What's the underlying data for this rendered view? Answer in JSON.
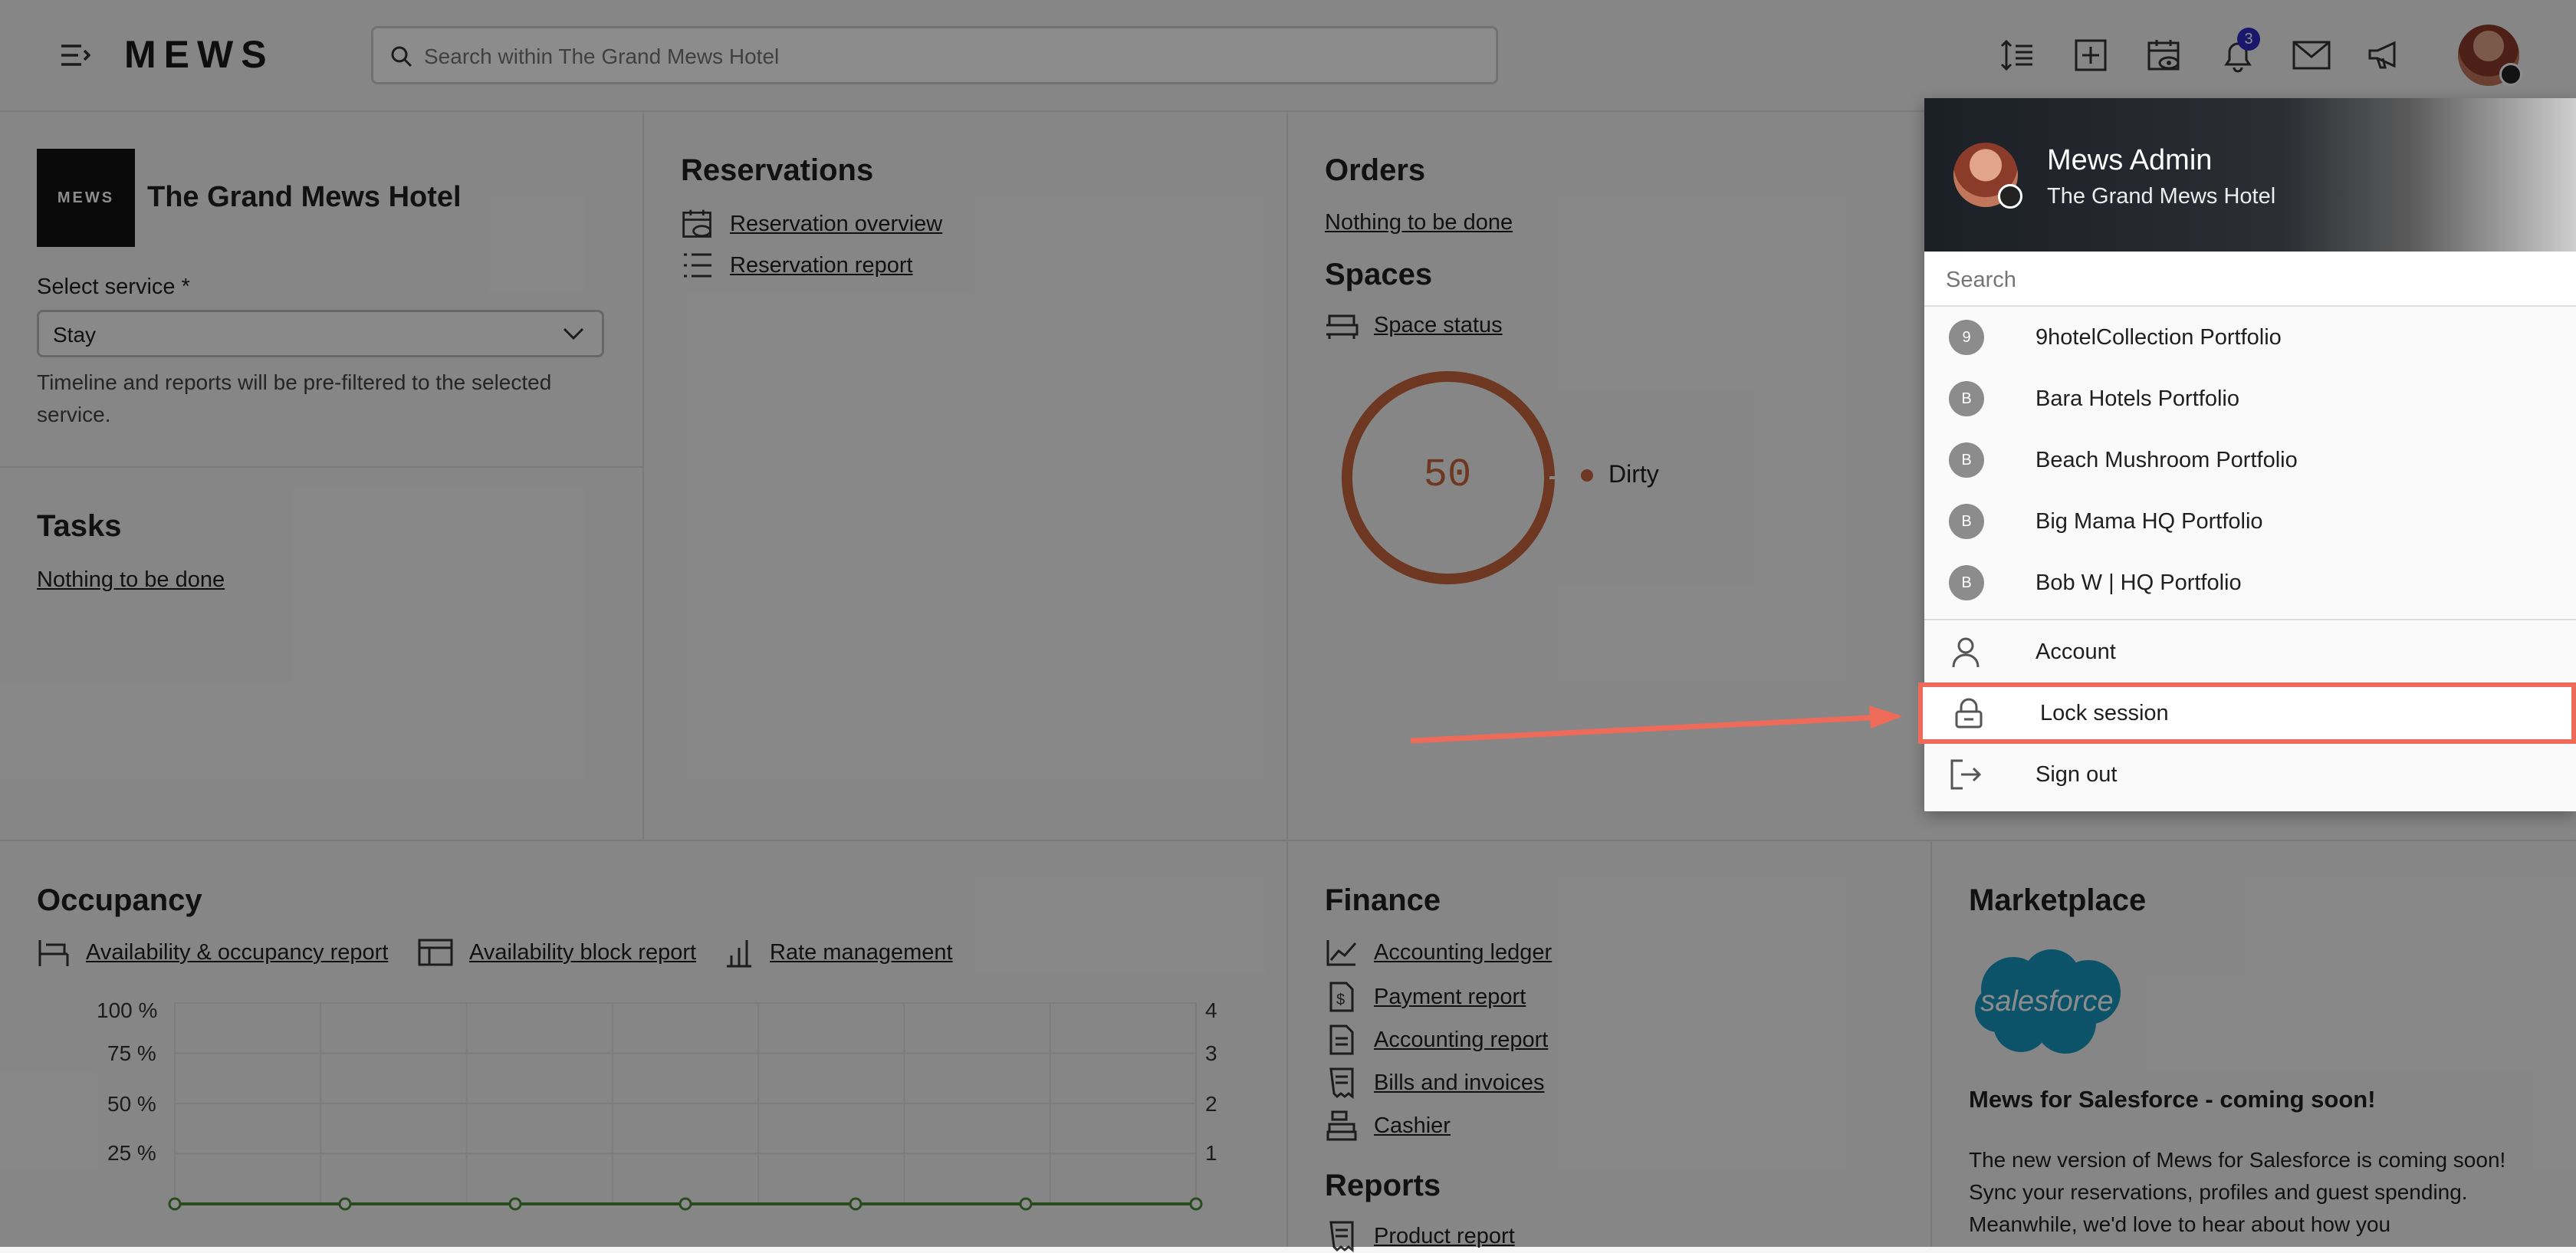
{
  "app": {
    "logo": "MEWS"
  },
  "search": {
    "placeholder": "Search within The Grand Mews Hotel"
  },
  "topbar": {
    "notification_count": "3"
  },
  "hotel": {
    "name": "The Grand Mews Hotel",
    "logo_text": "MEWS"
  },
  "service": {
    "label": "Select service *",
    "value": "Stay",
    "hint": "Timeline and reports will be pre-filtered to the selected service."
  },
  "tasks": {
    "title": "Tasks",
    "link": "Nothing to be done"
  },
  "reservations": {
    "title": "Reservations",
    "links": [
      "Reservation overview",
      "Reservation report"
    ]
  },
  "orders": {
    "title": "Orders",
    "link": "Nothing to be done"
  },
  "spaces": {
    "title": "Spaces",
    "link": "Space status",
    "value": "50",
    "legend": "Dirty"
  },
  "occupancy": {
    "title": "Occupancy",
    "links": [
      "Availability & occupancy report",
      "Availability block report",
      "Rate management"
    ]
  },
  "finance": {
    "title": "Finance",
    "links": [
      "Accounting ledger",
      "Payment report",
      "Accounting report",
      "Bills and invoices",
      "Cashier"
    ]
  },
  "reports": {
    "title": "Reports",
    "links": [
      "Product report"
    ]
  },
  "marketplace": {
    "title": "Marketplace",
    "logo_text": "salesforce",
    "heading": "Mews for Salesforce - coming soon!",
    "text": "The new version of Mews for Salesforce is coming soon! Sync your reservations, profiles and guest spending. Meanwhile, we'd love to hear about how you"
  },
  "chart_data": {
    "type": "line",
    "title": "",
    "y_left_ticks": [
      "100 %",
      "75 %",
      "50 %",
      "25 %"
    ],
    "y_right_ticks": [
      "4",
      "3",
      "2",
      "1"
    ],
    "series": [
      {
        "values": [
          0,
          0,
          0,
          0,
          0,
          0,
          0
        ]
      }
    ],
    "color": "#4a8a3a"
  },
  "user_menu": {
    "name": "Mews Admin",
    "property": "The Grand Mews Hotel",
    "search_placeholder": "Search",
    "portfolios": [
      {
        "initial": "9",
        "label": "9hotelCollection Portfolio"
      },
      {
        "initial": "B",
        "label": "Bara Hotels Portfolio"
      },
      {
        "initial": "B",
        "label": "Beach Mushroom Portfolio"
      },
      {
        "initial": "B",
        "label": "Big Mama HQ Portfolio"
      },
      {
        "initial": "B",
        "label": "Bob W | HQ Portfolio"
      }
    ],
    "account": "Account",
    "lock": "Lock session",
    "signout": "Sign out"
  },
  "colors": {
    "accent": "#ee6b5a",
    "donut": "#c8653c",
    "badge": "#2e2ac4"
  }
}
